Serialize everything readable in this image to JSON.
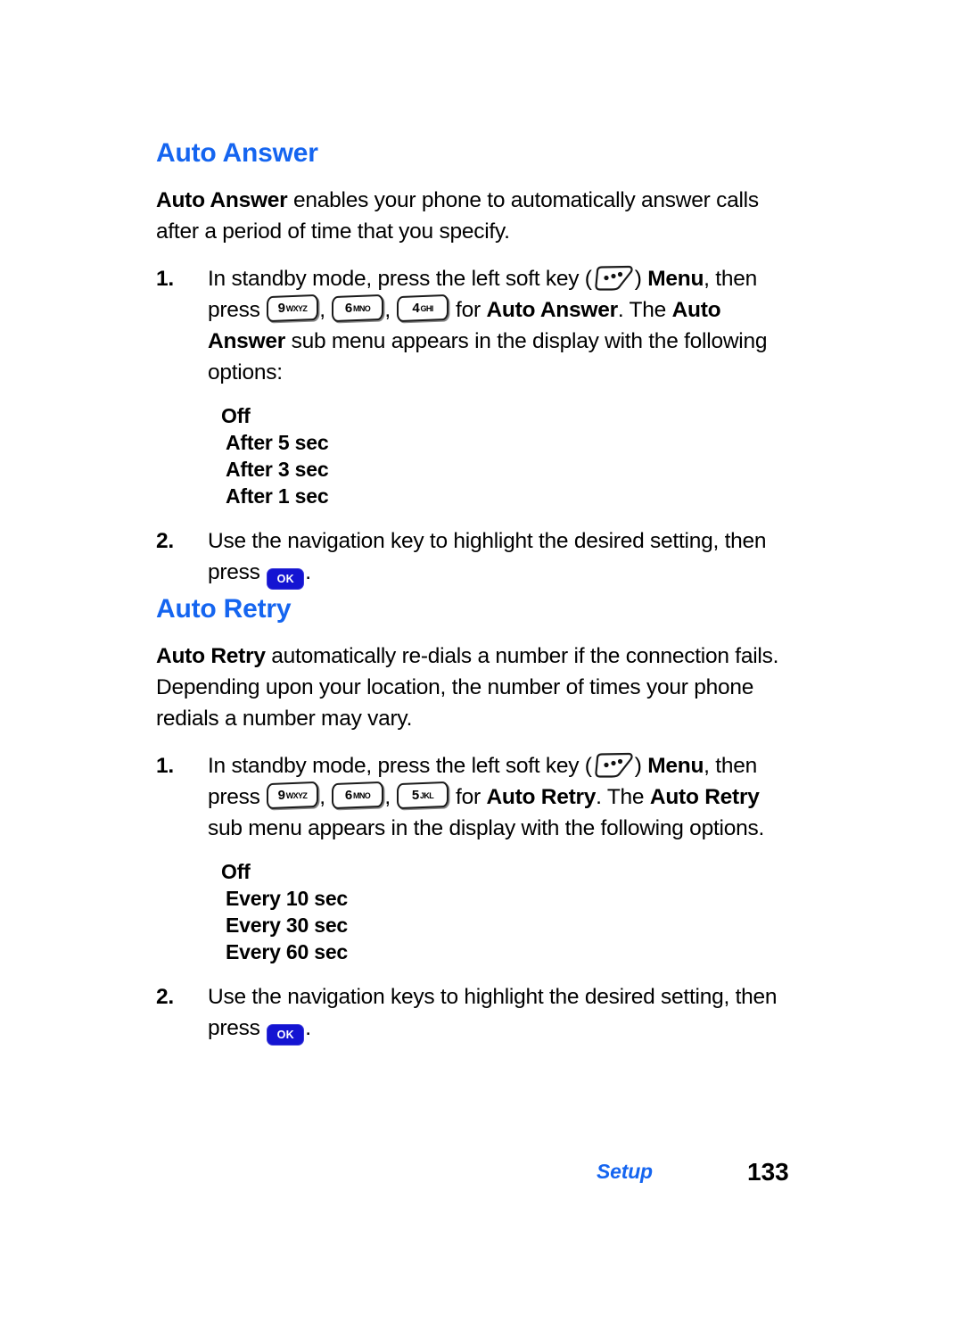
{
  "document": {
    "type": "phone-user-manual-page",
    "page_number": "133",
    "chapter": "Setup"
  },
  "sections": [
    {
      "heading": "Auto Answer",
      "intro": {
        "lead": "Auto Answer",
        "rest": " enables your phone to automatically answer calls after a period of time that you specify."
      },
      "steps": [
        {
          "number": "1.",
          "text_parts": {
            "p1": "In standby mode, press the left soft key (",
            "p2": ") ",
            "menu": "Menu",
            "p3": ", then press ",
            "p4": ", ",
            "p5": ", ",
            "p6": " for ",
            "target1": "Auto Answer",
            "p7": ". The ",
            "target2": "Auto Answer",
            "p8": " sub menu appears in the display with the following options:"
          },
          "keys": [
            {
              "digit": "9",
              "letters": "WXYZ"
            },
            {
              "digit": "6",
              "letters": "MNO"
            },
            {
              "digit": "4",
              "letters": "GHI"
            }
          ]
        },
        {
          "number": "2.",
          "text_parts": {
            "p1": "Use the navigation key to highlight the desired setting, then press ",
            "ok_label": "OK",
            "p2": "."
          }
        }
      ],
      "options": [
        "Off",
        "After 5 sec",
        "After 3 sec",
        "After 1 sec"
      ]
    },
    {
      "heading": "Auto Retry",
      "intro": {
        "lead": "Auto Retry",
        "rest": " automatically re-dials a number if the connection fails. Depending upon your location, the number of times your phone redials a number may vary."
      },
      "steps": [
        {
          "number": "1.",
          "text_parts": {
            "p1": "In standby mode, press the left soft key (",
            "p2": ") ",
            "menu": "Menu",
            "p3": ", then press ",
            "p4": ", ",
            "p5": ", ",
            "p6": " for ",
            "target1": "Auto Retry",
            "p7": ". The ",
            "target2": "Auto Retry",
            "p8": " sub menu appears in the display with the following options."
          },
          "keys": [
            {
              "digit": "9",
              "letters": "WXYZ"
            },
            {
              "digit": "6",
              "letters": "MNO"
            },
            {
              "digit": "5",
              "letters": "JKL"
            }
          ]
        },
        {
          "number": "2.",
          "text_parts": {
            "p1": "Use the navigation keys to highlight the desired setting, then press ",
            "ok_label": "OK",
            "p2": "."
          }
        }
      ],
      "options": [
        "Off",
        "Every 10 sec",
        "Every 30 sec",
        "Every 60 sec"
      ]
    }
  ],
  "icons": {
    "soft_key": "left-soft-key-icon",
    "ok_key": "ok-key-icon"
  },
  "colors": {
    "heading_blue": "#1565F0",
    "ok_key_blue": "#1414D2",
    "text_black": "#000000",
    "page_background": "#FFFFFF"
  }
}
